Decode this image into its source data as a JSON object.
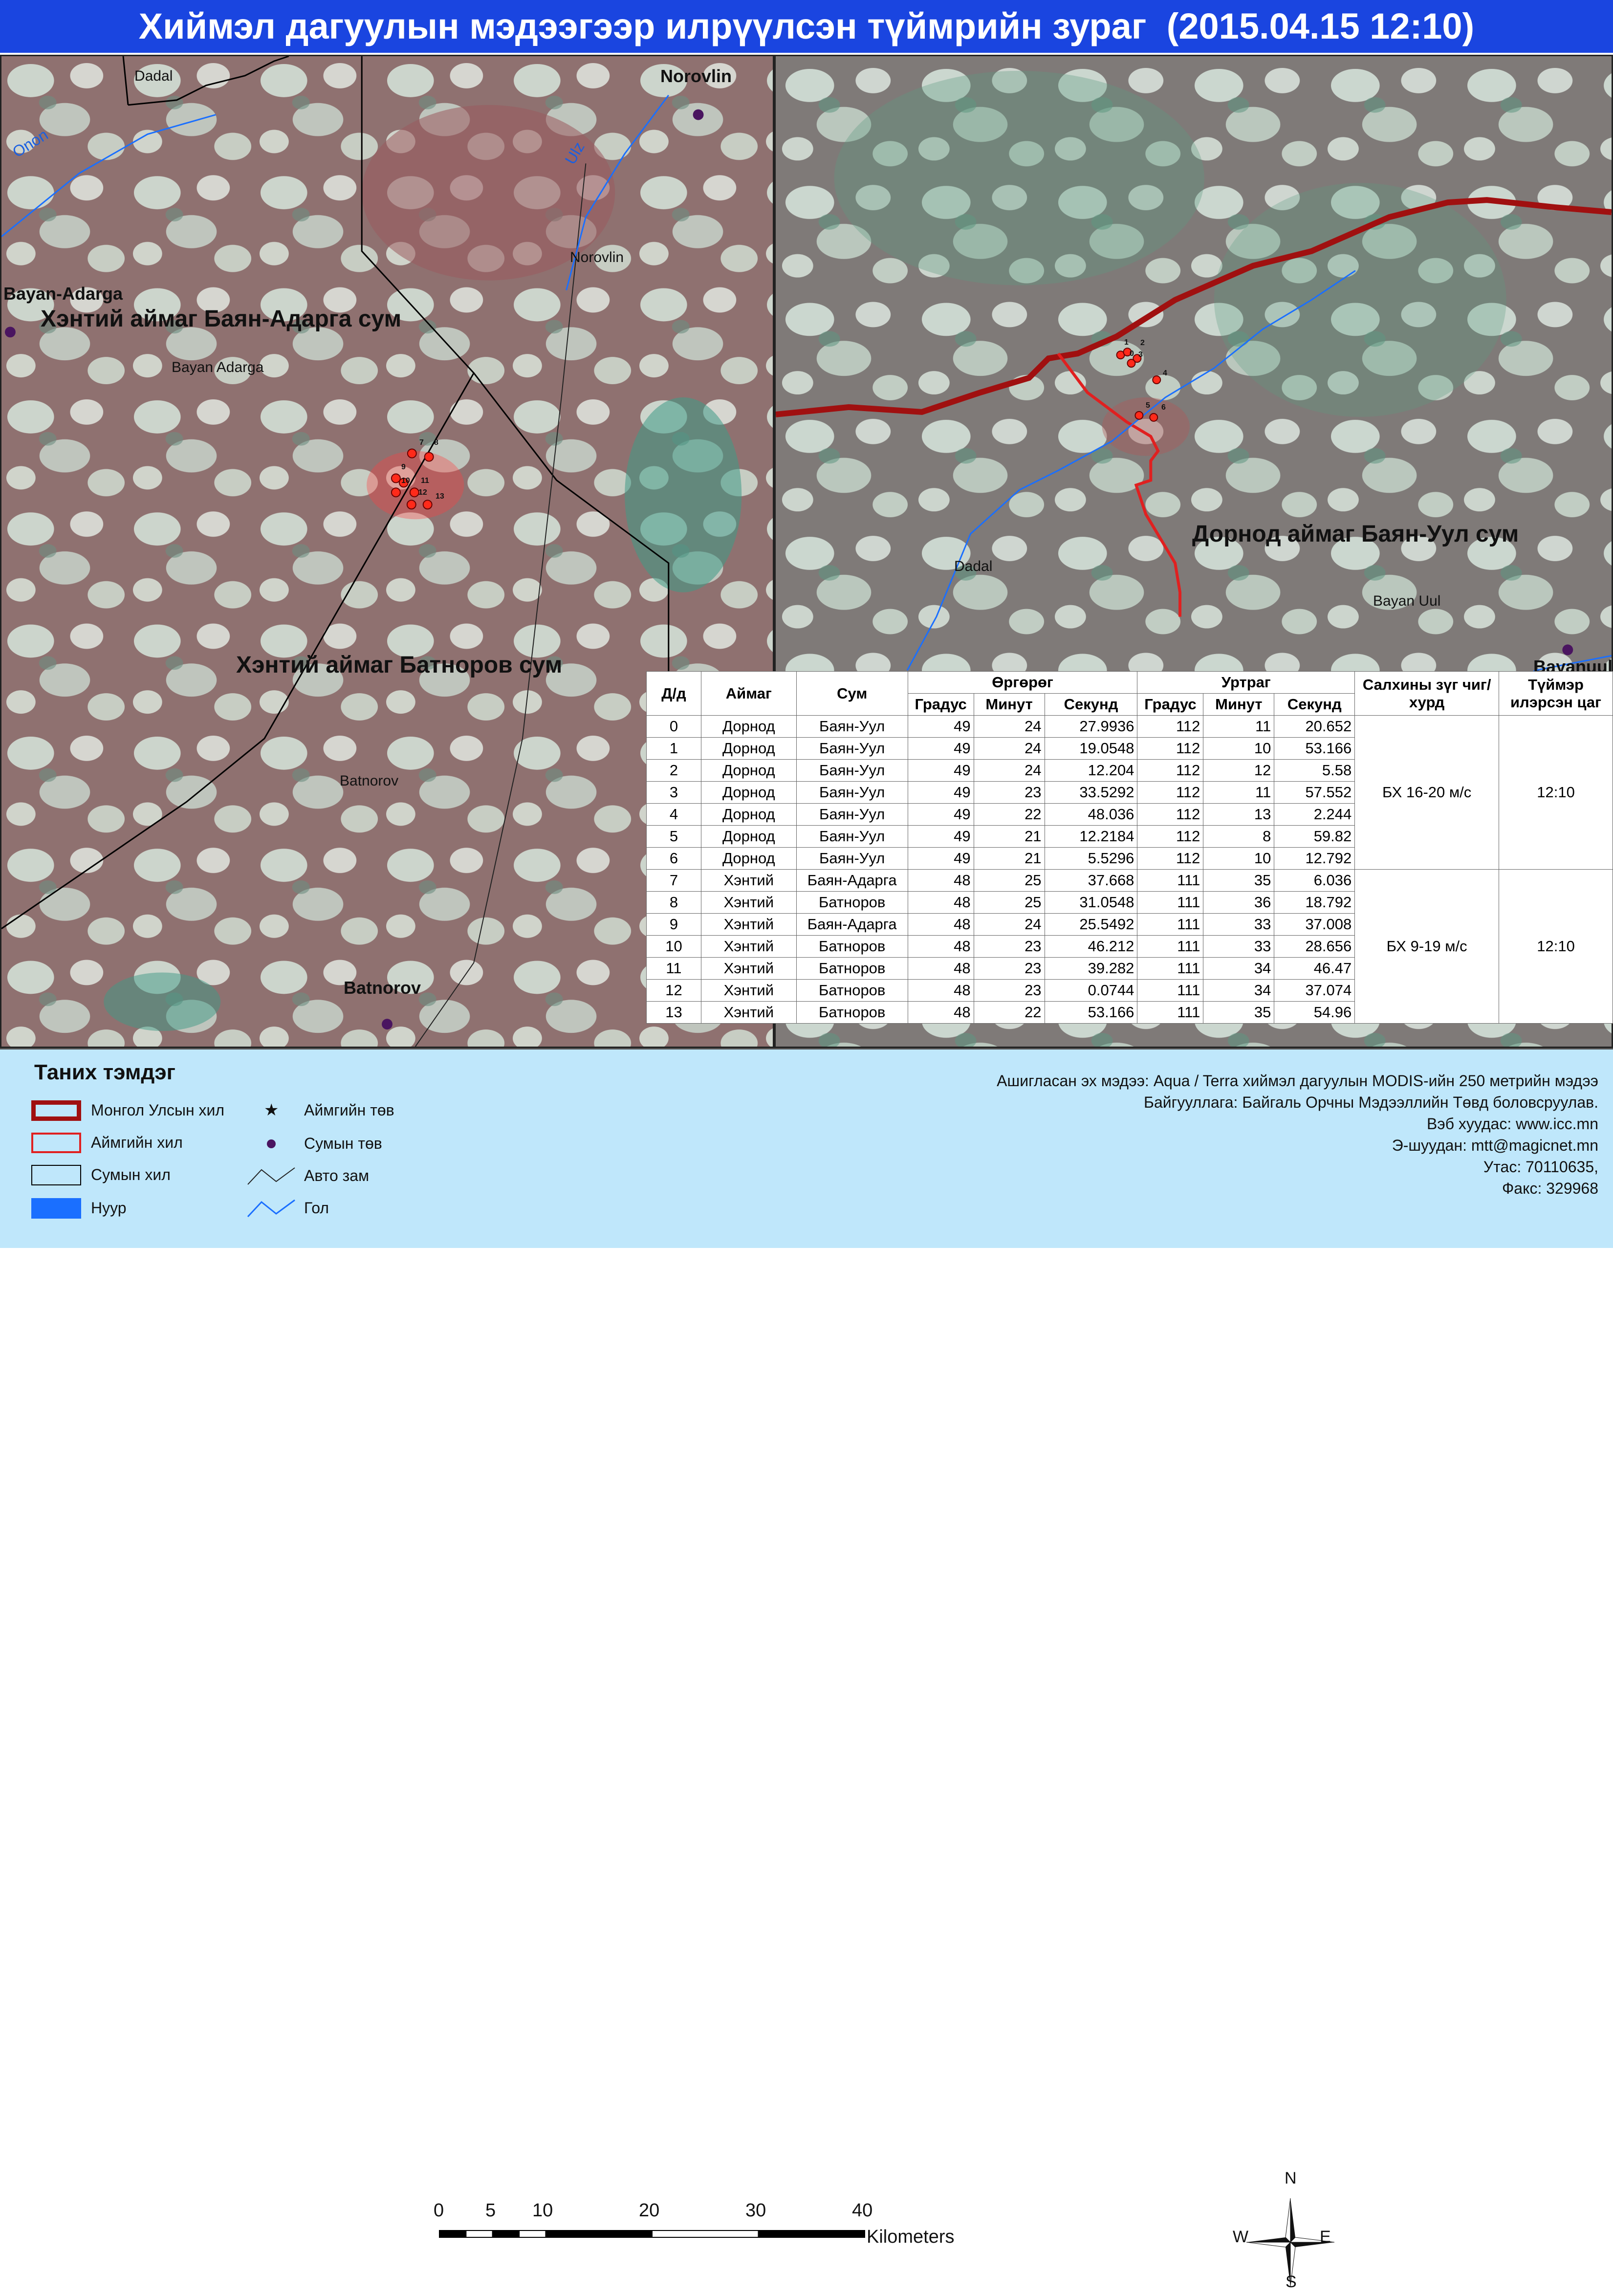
{
  "title": "Хиймэл дагуулын мэдээгээр илрүүлсэн түймрийн зураг  (2015.04.15 12:10)",
  "colors": {
    "title_bg": "#1a45e0",
    "legend_bg": "#bfe7fb",
    "national_border": "#a01010",
    "aimag_border": "#e02020",
    "soum_border": "#000000",
    "lake": "#1a6fff",
    "river": "#1a6fff",
    "fire": "#ff2a1a"
  },
  "map_left": {
    "places": {
      "dadal": "Dadal",
      "norovlin_bold": "Norovlin",
      "norovlin": "Norovlin",
      "bayan_adarga_bold": "Bayan-Adarga",
      "bayan_adarga": "Bayan Adarga",
      "batnorov": "Batnorov",
      "batnorov_bold": "Batnorov"
    },
    "rivers": {
      "onon": "Onon",
      "ulz": "Ulz"
    },
    "regions": {
      "bayan_adarga": "Хэнтий аймаг Баян-Адарга сум",
      "batnorov": "Хэнтий аймаг Батноров сум"
    },
    "fire_labels": [
      "7",
      "8",
      "9",
      "10",
      "11",
      "12",
      "13"
    ]
  },
  "map_right": {
    "places": {
      "dadal": "Dadal",
      "bayan_uul": "Bayan Uul",
      "bayanuul_bold": "Bayanuul"
    },
    "regions": {
      "bayan_uul": "Дорнод аймаг Баян-Уул сум"
    },
    "fire_labels": [
      "1",
      "2",
      "0",
      "3",
      "4",
      "5",
      "6"
    ]
  },
  "table": {
    "headers": {
      "id": "Д/д",
      "aimag": "Аймаг",
      "soum": "Сум",
      "latitude": "Өргөрөг",
      "longitude": "Уртраг",
      "wind": "Салхины зүг чиг/хурд",
      "time": "Түймэр илэрсэн цаг",
      "deg": "Градус",
      "min": "Минут",
      "sec": "Секунд"
    },
    "rows": [
      {
        "id": "0",
        "aimag": "Дорнод",
        "soum": "Баян-Уул",
        "lat_d": "49",
        "lat_m": "24",
        "lat_s": "27.9936",
        "lon_d": "112",
        "lon_m": "11",
        "lon_s": "20.652"
      },
      {
        "id": "1",
        "aimag": "Дорнод",
        "soum": "Баян-Уул",
        "lat_d": "49",
        "lat_m": "24",
        "lat_s": "19.0548",
        "lon_d": "112",
        "lon_m": "10",
        "lon_s": "53.166"
      },
      {
        "id": "2",
        "aimag": "Дорнод",
        "soum": "Баян-Уул",
        "lat_d": "49",
        "lat_m": "24",
        "lat_s": "12.204",
        "lon_d": "112",
        "lon_m": "12",
        "lon_s": "5.58"
      },
      {
        "id": "3",
        "aimag": "Дорнод",
        "soum": "Баян-Уул",
        "lat_d": "49",
        "lat_m": "23",
        "lat_s": "33.5292",
        "lon_d": "112",
        "lon_m": "11",
        "lon_s": "57.552"
      },
      {
        "id": "4",
        "aimag": "Дорнод",
        "soum": "Баян-Уул",
        "lat_d": "49",
        "lat_m": "22",
        "lat_s": "48.036",
        "lon_d": "112",
        "lon_m": "13",
        "lon_s": "2.244"
      },
      {
        "id": "5",
        "aimag": "Дорнод",
        "soum": "Баян-Уул",
        "lat_d": "49",
        "lat_m": "21",
        "lat_s": "12.2184",
        "lon_d": "112",
        "lon_m": "8",
        "lon_s": "59.82"
      },
      {
        "id": "6",
        "aimag": "Дорнод",
        "soum": "Баян-Уул",
        "lat_d": "49",
        "lat_m": "21",
        "lat_s": "5.5296",
        "lon_d": "112",
        "lon_m": "10",
        "lon_s": "12.792"
      },
      {
        "id": "7",
        "aimag": "Хэнтий",
        "soum": "Баян-Адарга",
        "lat_d": "48",
        "lat_m": "25",
        "lat_s": "37.668",
        "lon_d": "111",
        "lon_m": "35",
        "lon_s": "6.036"
      },
      {
        "id": "8",
        "aimag": "Хэнтий",
        "soum": "Батноров",
        "lat_d": "48",
        "lat_m": "25",
        "lat_s": "31.0548",
        "lon_d": "111",
        "lon_m": "36",
        "lon_s": "18.792"
      },
      {
        "id": "9",
        "aimag": "Хэнтий",
        "soum": "Баян-Адарга",
        "lat_d": "48",
        "lat_m": "24",
        "lat_s": "25.5492",
        "lon_d": "111",
        "lon_m": "33",
        "lon_s": "37.008"
      },
      {
        "id": "10",
        "aimag": "Хэнтий",
        "soum": "Батноров",
        "lat_d": "48",
        "lat_m": "23",
        "lat_s": "46.212",
        "lon_d": "111",
        "lon_m": "33",
        "lon_s": "28.656"
      },
      {
        "id": "11",
        "aimag": "Хэнтий",
        "soum": "Батноров",
        "lat_d": "48",
        "lat_m": "23",
        "lat_s": "39.282",
        "lon_d": "111",
        "lon_m": "34",
        "lon_s": "46.47"
      },
      {
        "id": "12",
        "aimag": "Хэнтий",
        "soum": "Батноров",
        "lat_d": "48",
        "lat_m": "23",
        "lat_s": "0.0744",
        "lon_d": "111",
        "lon_m": "34",
        "lon_s": "37.074"
      },
      {
        "id": "13",
        "aimag": "Хэнтий",
        "soum": "Батноров",
        "lat_d": "48",
        "lat_m": "22",
        "lat_s": "53.166",
        "lon_d": "111",
        "lon_m": "35",
        "lon_s": "54.96"
      }
    ],
    "groups": [
      {
        "wind": "БХ 16-20 м/с",
        "time": "12:10"
      },
      {
        "wind": "БХ 9-19 м/с",
        "time": "12:10"
      }
    ]
  },
  "legend": {
    "title": "Таних тэмдэг",
    "national_border": "Монгол Улсын хил",
    "aimag_border": "Аймгийн хил",
    "soum_border": "Сумын хил",
    "lake": "Нуур",
    "aimag_center": "Аймгийн төв",
    "soum_center": "Сумын төв",
    "road": "Авто зам",
    "river": "Гол",
    "star_glyph": "★"
  },
  "info": {
    "source": "Ашигласан эх мэдээ: Aqua / Terra хиймэл дагуулын MODIS-ийн 250 метрийн мэдээ",
    "org": "Байгууллага: Байгаль Орчны Мэдээллийн Төвд боловсруулав.",
    "web": "Вэб хуудас: www.icc.mn",
    "email": "Э-шуудан: mtt@magicnet.mn",
    "phone": "Утас: 70110635,",
    "fax": "Факс: 329968"
  },
  "scale": {
    "ticks": [
      "0",
      "5",
      "10",
      "20",
      "30",
      "40"
    ],
    "tick_km": [
      0,
      5,
      10,
      20,
      30,
      40
    ],
    "unit": "Kilometers"
  },
  "compass": {
    "n": "N",
    "s": "S",
    "e": "E",
    "w": "W"
  }
}
